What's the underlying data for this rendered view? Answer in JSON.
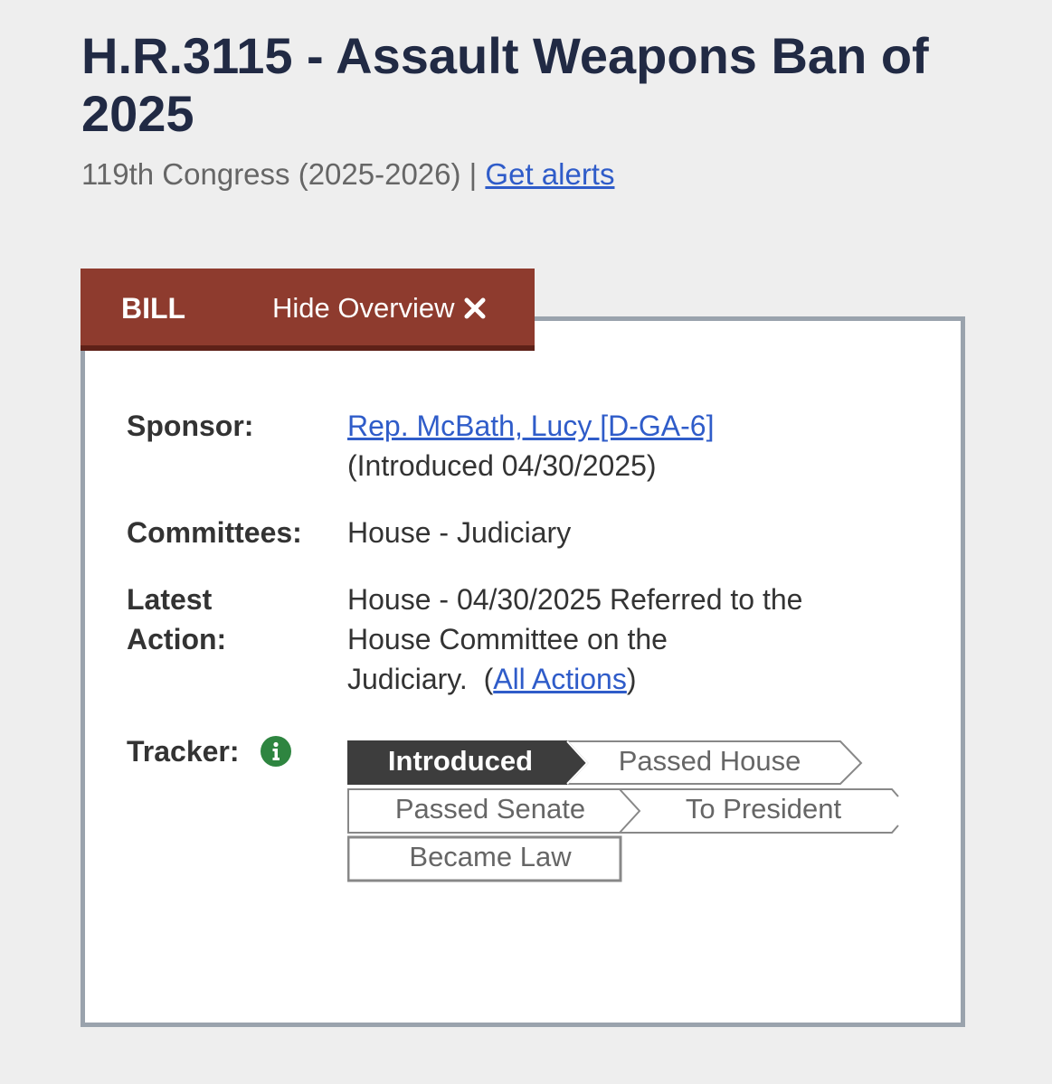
{
  "header": {
    "title": "H.R.3115 - Assault Weapons Ban of 2025",
    "congress": "119th Congress (2025-2026)",
    "separator": "|",
    "alerts_link": "Get alerts"
  },
  "tabs": {
    "bill_label": "BILL",
    "hide_overview_label": "Hide Overview"
  },
  "overview": {
    "sponsor_label": "Sponsor:",
    "sponsor_name": "Rep. McBath, Lucy [D-GA-6]",
    "sponsor_introduced": "(Introduced 04/30/2025)",
    "committees_label": "Committees:",
    "committees_value": "House - Judiciary",
    "latest_action_label_line1": "Latest",
    "latest_action_label_line2": "Action:",
    "latest_action_line1": "House - 04/30/2025 Referred to the",
    "latest_action_line2": "House Committee on the",
    "latest_action_line3": "Judiciary.",
    "latest_action_open_paren": "(",
    "all_actions_link": "All Actions",
    "latest_action_close_paren": ")",
    "tracker_label": "Tracker:"
  },
  "tracker": {
    "steps": [
      {
        "label": "Introduced",
        "active": true
      },
      {
        "label": "Passed House",
        "active": false
      },
      {
        "label": "Passed Senate",
        "active": false
      },
      {
        "label": "To President",
        "active": false
      },
      {
        "label": "Became Law",
        "active": false
      }
    ]
  },
  "colors": {
    "title": "#212a44",
    "tab_bg": "#8e3b2e",
    "link": "#2f5cc9",
    "tracker_active": "#3d3d3d",
    "info_icon": "#2e8540"
  },
  "icons": {
    "close": "close-icon",
    "info": "info-icon"
  }
}
